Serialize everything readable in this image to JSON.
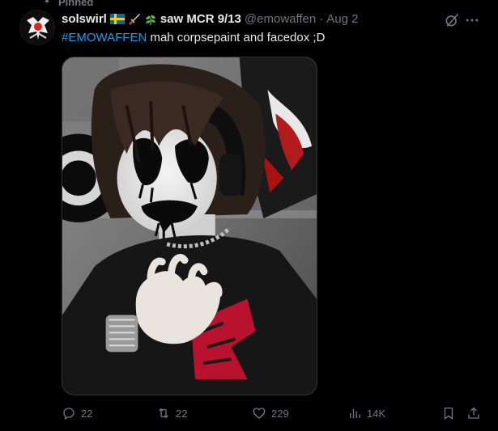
{
  "pinned": {
    "label": "Pinned"
  },
  "author": {
    "name": "solswirl",
    "emojis": [
      "swedish-flag",
      "dagger",
      "herb"
    ],
    "name_suffix": "saw MCR 9/13",
    "handle": "@emowaffen",
    "separator": "·",
    "date": "Aug 2"
  },
  "tweet": {
    "hashtag": "#EMOWAFFEN",
    "text": " mah corpsepaint and facedox ;D"
  },
  "actions": {
    "replies": "22",
    "reposts": "22",
    "likes": "229",
    "views": "14K"
  },
  "icons": [
    "pin-icon",
    "grok-icon",
    "more-icon",
    "reply-icon",
    "repost-icon",
    "like-icon",
    "views-icon",
    "bookmark-icon",
    "share-icon"
  ],
  "colors": {
    "accent": "#1d9bf0",
    "muted": "#71767b",
    "text": "#e7e9ea",
    "background": "#000000"
  }
}
